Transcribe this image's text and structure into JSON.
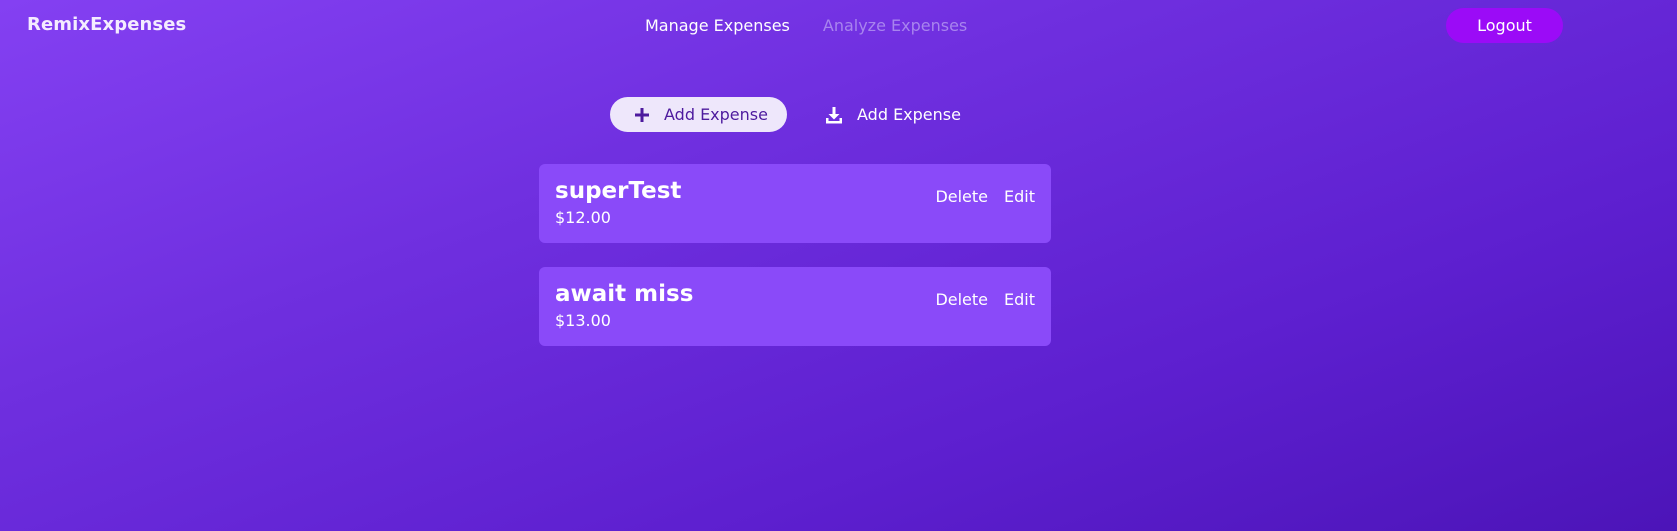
{
  "header": {
    "logo": "RemixExpenses",
    "nav": [
      {
        "label": "Manage Expenses",
        "active": true
      },
      {
        "label": "Analyze Expenses",
        "active": false
      }
    ],
    "logout_label": "Logout"
  },
  "actions": {
    "add_label": "Add Expense",
    "load_label": "Add Expense"
  },
  "expenses": [
    {
      "title": "superTest",
      "amount": "$12.00",
      "delete_label": "Delete",
      "edit_label": "Edit"
    },
    {
      "title": "await miss",
      "amount": "$13.00",
      "delete_label": "Delete",
      "edit_label": "Edit"
    }
  ],
  "icons": {
    "add": "plus-icon",
    "load": "download-icon"
  },
  "colors": {
    "background_start": "#8440f2",
    "background_end": "#4c14b8",
    "logout_button": "#9b0bf7",
    "add_button": "#eee7fb",
    "card": "#8a4af9",
    "inactive_nav": "#a884ee"
  }
}
